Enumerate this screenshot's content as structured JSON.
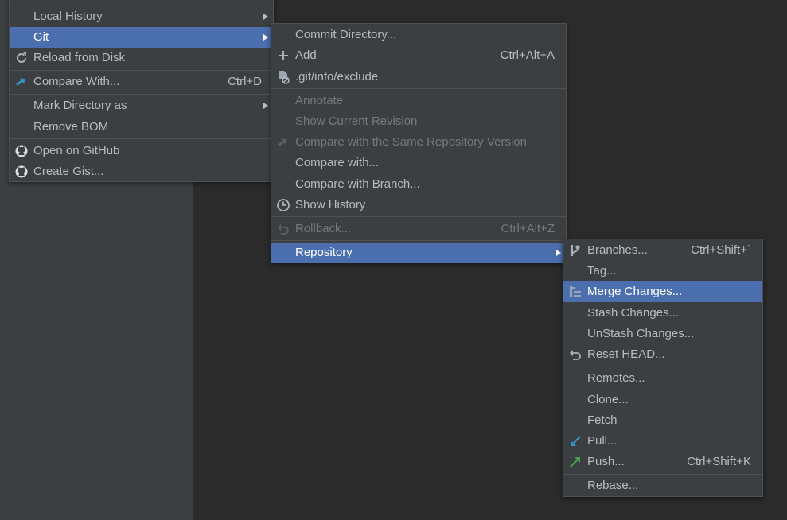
{
  "menu1": {
    "items": [
      {
        "label": "Local History"
      },
      {
        "label": "Git"
      },
      {
        "label": "Reload from Disk",
        "icon": "reload-icon"
      },
      {
        "label": "Compare With...",
        "shortcut": "Ctrl+D",
        "icon": "compare-icon"
      },
      {
        "label": "Mark Directory as"
      },
      {
        "label": "Remove BOM"
      },
      {
        "label": "Open on GitHub",
        "icon": "github-icon"
      },
      {
        "label": "Create Gist...",
        "icon": "github-icon"
      }
    ]
  },
  "menu2": {
    "items": [
      {
        "label": "Commit Directory..."
      },
      {
        "label": "Add",
        "shortcut": "Ctrl+Alt+A",
        "icon": "plus-icon"
      },
      {
        "label": ".git/info/exclude",
        "icon": "ignore-file-icon"
      },
      {
        "label": "Annotate",
        "disabled": true
      },
      {
        "label": "Show Current Revision",
        "disabled": true
      },
      {
        "label": "Compare with the Same Repository Version",
        "disabled": true,
        "icon": "compare-icon"
      },
      {
        "label": "Compare with..."
      },
      {
        "label": "Compare with Branch..."
      },
      {
        "label": "Show History",
        "icon": "clock-icon"
      },
      {
        "label": "Rollback...",
        "shortcut": "Ctrl+Alt+Z",
        "disabled": true,
        "icon": "undo-icon"
      },
      {
        "label": "Repository"
      }
    ]
  },
  "menu3": {
    "items": [
      {
        "label": "Branches...",
        "shortcut": "Ctrl+Shift+`",
        "icon": "branch-icon"
      },
      {
        "label": "Tag..."
      },
      {
        "label": "Merge Changes...",
        "icon": "merge-icon"
      },
      {
        "label": "Stash Changes..."
      },
      {
        "label": "UnStash Changes..."
      },
      {
        "label": "Reset HEAD...",
        "icon": "undo-icon"
      },
      {
        "label": "Remotes..."
      },
      {
        "label": "Clone..."
      },
      {
        "label": "Fetch"
      },
      {
        "label": "Pull...",
        "icon": "pull-arrow-icon"
      },
      {
        "label": "Push...",
        "shortcut": "Ctrl+Shift+K",
        "icon": "push-arrow-icon"
      },
      {
        "label": "Rebase..."
      }
    ]
  },
  "colors": {
    "background": "#2b2b2b",
    "menu": "#3c3f41",
    "selection": "#4b6eaf",
    "text": "#bbbbbb",
    "disabled_text": "#787878",
    "pull_icon": "#3592c4",
    "push_icon": "#499c54"
  }
}
